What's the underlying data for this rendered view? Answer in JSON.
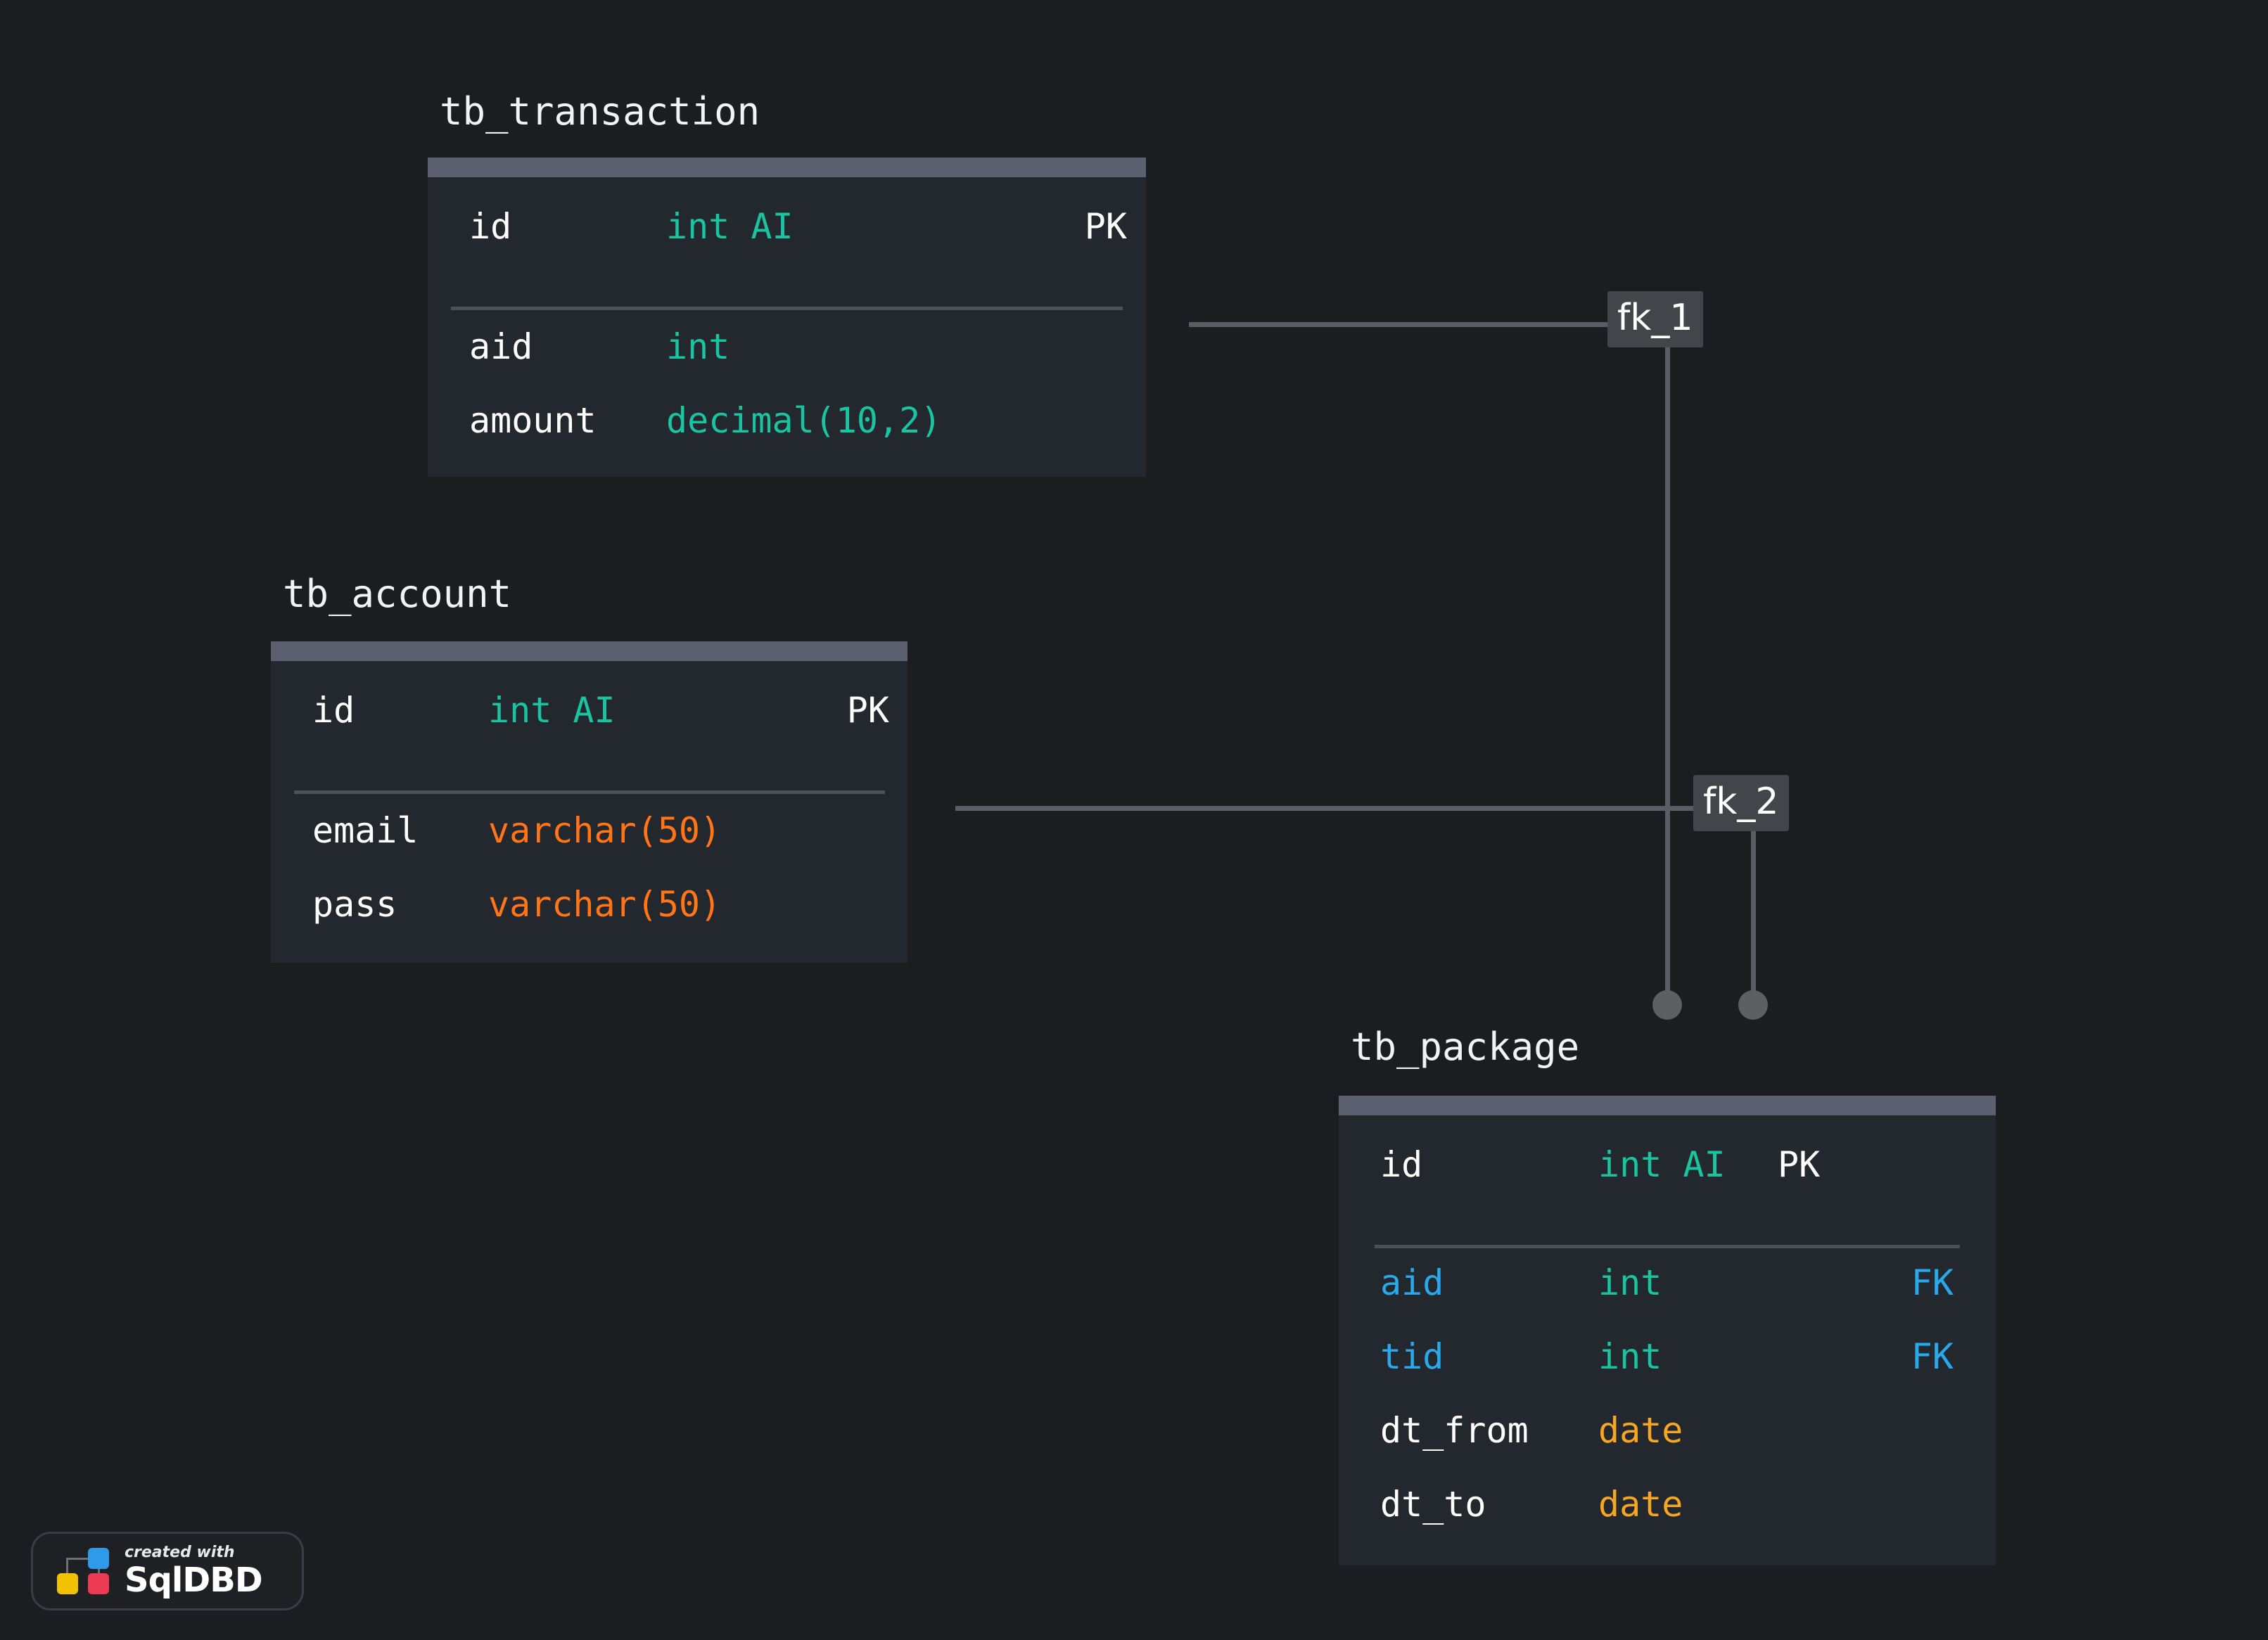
{
  "diagram": {
    "type": "entity-relationship-diagram",
    "background_color": "#1b1d21",
    "tables": [
      {
        "id": "tb_transaction",
        "name": "tb_transaction",
        "header_color": "#5a606f",
        "body_color": "#23272e",
        "columns": [
          {
            "name": "id",
            "type": "int AI",
            "key": "PK",
            "is_pk": true,
            "is_fk": false
          },
          {
            "name": "aid",
            "type": "int",
            "key": "",
            "is_pk": false,
            "is_fk": false
          },
          {
            "name": "amount",
            "type": "decimal(10,2)",
            "key": "",
            "is_pk": false,
            "is_fk": false
          }
        ]
      },
      {
        "id": "tb_account",
        "name": "tb_account",
        "header_color": "#5a606f",
        "body_color": "#23272e",
        "columns": [
          {
            "name": "id",
            "type": "int AI",
            "key": "PK",
            "is_pk": true,
            "is_fk": false
          },
          {
            "name": "email",
            "type": "varchar(50)",
            "key": "",
            "is_pk": false,
            "is_fk": false
          },
          {
            "name": "pass",
            "type": "varchar(50)",
            "key": "",
            "is_pk": false,
            "is_fk": false
          }
        ]
      },
      {
        "id": "tb_package",
        "name": "tb_package",
        "header_color": "#5a606f",
        "body_color": "#23272e",
        "columns": [
          {
            "name": "id",
            "type": "int AI",
            "key": "PK",
            "is_pk": true,
            "is_fk": false
          },
          {
            "name": "aid",
            "type": "int",
            "key": "FK",
            "is_pk": false,
            "is_fk": true
          },
          {
            "name": "tid",
            "type": "int",
            "key": "FK",
            "is_pk": false,
            "is_fk": true
          },
          {
            "name": "dt_from",
            "type": "date",
            "key": "",
            "is_pk": false,
            "is_fk": false
          },
          {
            "name": "dt_to",
            "type": "date",
            "key": "",
            "is_pk": false,
            "is_fk": false
          }
        ]
      }
    ],
    "relationships": [
      {
        "id": "fk_1",
        "label": "fk_1",
        "from_table": "tb_transaction",
        "to_table": "tb_package",
        "to_column": "tid"
      },
      {
        "id": "fk_2",
        "label": "fk_2",
        "from_table": "tb_account",
        "to_table": "tb_package",
        "to_column": "aid"
      }
    ],
    "colors": {
      "column_name": "#ffffff",
      "column_name_fk": "#29a8ea",
      "type_numeric": "#1bc4a0",
      "type_varchar": "#ff7518",
      "type_date": "#f5a623",
      "key_pk": "#ffffff",
      "key_fk": "#29a8ea",
      "relation_line": "#5a5d63",
      "relation_label_bg": "#43454a"
    }
  },
  "footer": {
    "badge": {
      "created_with": "created with",
      "product": "SqlDBD"
    }
  }
}
